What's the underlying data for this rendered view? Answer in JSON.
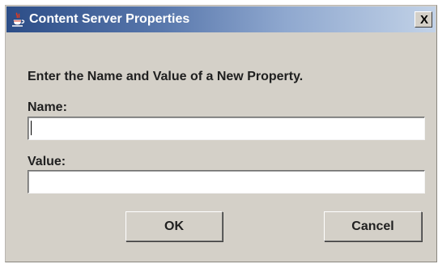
{
  "window": {
    "title": "Content Server Properties",
    "close_label": "X"
  },
  "form": {
    "prompt": "Enter the Name and Value of a New Property.",
    "name_label": "Name:",
    "name_value": "",
    "value_label": "Value:",
    "value_value": ""
  },
  "buttons": {
    "ok_label": "OK",
    "cancel_label": "Cancel"
  },
  "icons": {
    "title_icon": "java-coffee-cup-icon"
  },
  "colors": {
    "dialog_background": "#d4d0c8",
    "titlebar_start": "#2c4d87",
    "titlebar_end": "#c2d2e7",
    "title_text": "#ffffff"
  }
}
